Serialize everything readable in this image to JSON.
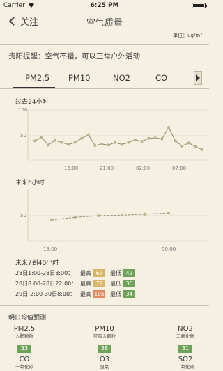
{
  "status": {
    "carrier": "Carrier",
    "time": "6:25 PM"
  },
  "nav": {
    "back_label": "关注",
    "title": "空气质量"
  },
  "unit": "单位：ug/m³",
  "reminder": "贵阳提醒：空气不错，可以正常户外活动",
  "tabs": [
    "PM2.5",
    "PM10",
    "NO2",
    "CO"
  ],
  "active_tab": "PM2.5",
  "past24": {
    "title": "过去24小时",
    "y_ticks": [
      "100",
      "50"
    ],
    "x_ticks": [
      "16:00",
      "21:00",
      "02:00",
      "07:00"
    ]
  },
  "next6": {
    "title": "未来6小时",
    "y_ticks": [
      "50"
    ],
    "x_ticks": [
      "19:00",
      "00:00"
    ]
  },
  "chart_data": [
    {
      "type": "line",
      "title": "过去24小时",
      "ylim": [
        0,
        120
      ],
      "x_ticks": [
        "16:00",
        "21:00",
        "02:00",
        "07:00"
      ],
      "series": [
        {
          "values": [
            40,
            47,
            32,
            41,
            37,
            33,
            37,
            45,
            52,
            31,
            34,
            32,
            37,
            33,
            37,
            42,
            39,
            45,
            46,
            44,
            66,
            40,
            30,
            36,
            29,
            23
          ]
        }
      ]
    },
    {
      "type": "line",
      "title": "未来6小时",
      "ylim": [
        0,
        120
      ],
      "x_ticks": [
        "19:00",
        "00:00"
      ],
      "series": [
        {
          "values": [
            42,
            47,
            50,
            51,
            53,
            55
          ]
        }
      ]
    }
  ],
  "future": {
    "title": "未来7到48小时",
    "high_label": "最高",
    "low_label": "最低",
    "rows": [
      {
        "date": "28日1:00-28日8:00：",
        "high": "67",
        "low": "42",
        "high_color": "#d9b56a",
        "low_color": "#6fa35a"
      },
      {
        "date": "28日8:00-28日22:00：",
        "high": "79",
        "low": "36",
        "high_color": "#d9b56a",
        "low_color": "#6fa35a"
      },
      {
        "date": "29日-2:00-30日8:00：",
        "high": "105",
        "low": "34",
        "high_color": "#e08a60",
        "low_color": "#6fa35a"
      }
    ]
  },
  "tomorrow": {
    "title": "明日均值预测",
    "items": [
      {
        "name": "PM2.5",
        "sub": "入肺颗粒",
        "value": "33",
        "color": "#6fa35a"
      },
      {
        "name": "PM10",
        "sub": "可吸入颗粒",
        "value": "38",
        "color": "#6fa35a"
      },
      {
        "name": "NO2",
        "sub": "二氧化氮",
        "value": "31",
        "color": "#6fa35a"
      },
      {
        "name": "CO",
        "sub": "一氧化碳",
        "value": "",
        "color": "#6fa35a"
      },
      {
        "name": "O3",
        "sub": "臭氧",
        "value": "",
        "color": "#6fa35a"
      },
      {
        "name": "SO2",
        "sub": "二氧化硫",
        "value": "",
        "color": "#6fa35a"
      }
    ]
  },
  "colors": {
    "background": "#f5f0e1",
    "chart_line": "#8a8a6a",
    "chart_point": "#b7b48a",
    "good": "#6fa35a",
    "moderate": "#d9b56a",
    "unhealthy": "#e08a60"
  }
}
